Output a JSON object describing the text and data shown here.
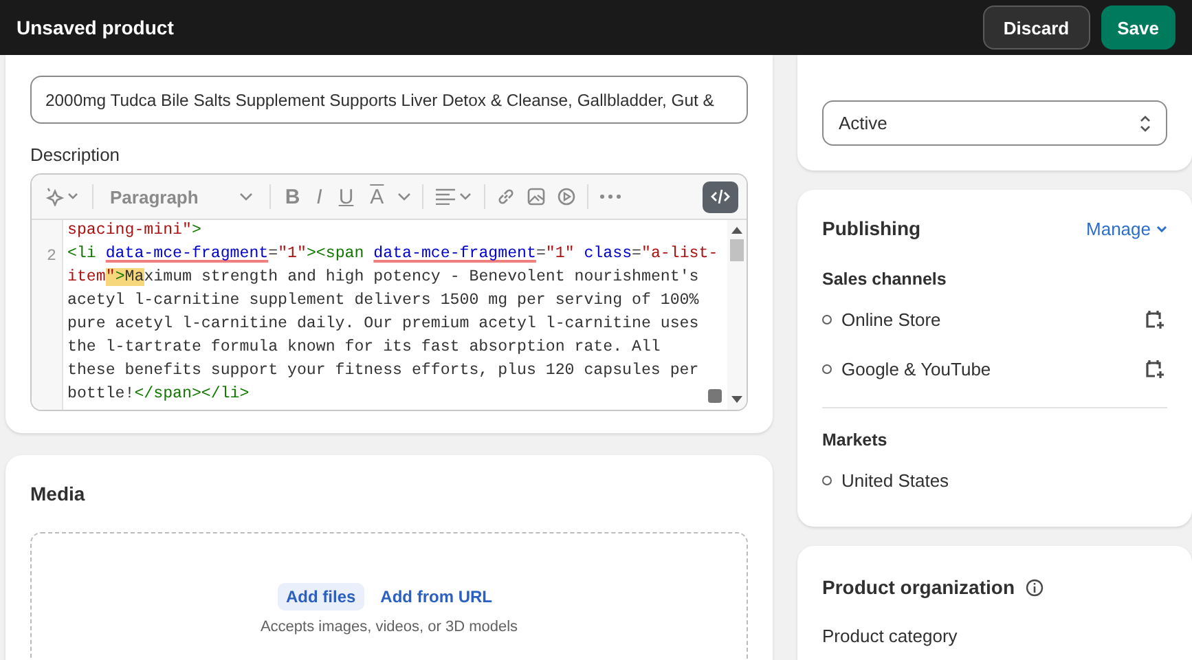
{
  "top_bar": {
    "title": "Unsaved product",
    "buttons": [
      {
        "label": "Discard",
        "kind": "secondary"
      },
      {
        "label": "Save",
        "kind": "primary"
      }
    ]
  },
  "title_field": {
    "value": "2000mg Tudca Bile Salts Supplement Supports Liver Detox & Cleanse, Gallbladder, Gut &"
  },
  "description": {
    "label": "Description",
    "style_select": "Paragraph",
    "format_buttons": [
      "B",
      "I",
      "U",
      "A"
    ],
    "source_view": true,
    "code_lines": [
      {
        "tokens": [
          {
            "kind": "value",
            "text": "spacing-mini\""
          },
          {
            "kind": "tag",
            "text": ">"
          }
        ]
      },
      {
        "number": "2",
        "tokens": [
          {
            "kind": "tag",
            "text": "<li "
          },
          {
            "kind": "attr",
            "text": "data-mce-fragment",
            "flagged": true
          },
          {
            "kind": "text",
            "text": "="
          },
          {
            "kind": "value",
            "text": "\"1\""
          },
          {
            "kind": "tag",
            "text": "><span "
          },
          {
            "kind": "attr",
            "text": "data-mce-fragment",
            "flagged": true
          },
          {
            "kind": "text",
            "text": "="
          },
          {
            "kind": "value",
            "text": "\"1\""
          },
          {
            "kind": "attr",
            "text": " class"
          },
          {
            "kind": "text",
            "text": "="
          },
          {
            "kind": "value",
            "text": "\"a-list-"
          }
        ]
      },
      {
        "tokens": [
          {
            "kind": "value",
            "text": "item"
          },
          {
            "kind": "value",
            "text": "\"",
            "highlighted": true
          },
          {
            "kind": "tag",
            "text": ">",
            "highlighted": true
          },
          {
            "kind": "text",
            "text": "Ma",
            "highlighted": true
          },
          {
            "kind": "text",
            "text": "ximum strength and high potency - Benevolent nourishment's"
          }
        ]
      },
      {
        "tokens": [
          {
            "kind": "text",
            "text": "acetyl l-carnitine supplement delivers 1500 mg per serving of 100%"
          }
        ]
      },
      {
        "tokens": [
          {
            "kind": "text",
            "text": "pure acetyl l-carnitine daily. Our premium acetyl l-carnitine uses"
          }
        ]
      },
      {
        "tokens": [
          {
            "kind": "text",
            "text": "the l-tartrate formula known for its fast absorption rate. All"
          }
        ]
      },
      {
        "tokens": [
          {
            "kind": "text",
            "text": "these benefits support your fitness efforts, plus 120 capsules per"
          }
        ]
      },
      {
        "tokens": [
          {
            "kind": "text",
            "text": "bottle!"
          },
          {
            "kind": "tag",
            "text": "</span></li>"
          }
        ]
      }
    ]
  },
  "media": {
    "title": "Media",
    "buttons": [
      {
        "label": "Add files",
        "kind": "tinted"
      },
      {
        "label": "Add from URL",
        "kind": "plain"
      }
    ],
    "hint": "Accepts images, videos, or 3D models"
  },
  "status": {
    "value": "Active"
  },
  "publishing": {
    "title": "Publishing",
    "manage": "Manage",
    "sales_channels_label": "Sales channels",
    "sales_channels": [
      "Online Store",
      "Google & YouTube"
    ],
    "markets_label": "Markets",
    "markets": [
      "United States"
    ]
  },
  "product_organization": {
    "title": "Product organization",
    "category_label": "Product category"
  }
}
